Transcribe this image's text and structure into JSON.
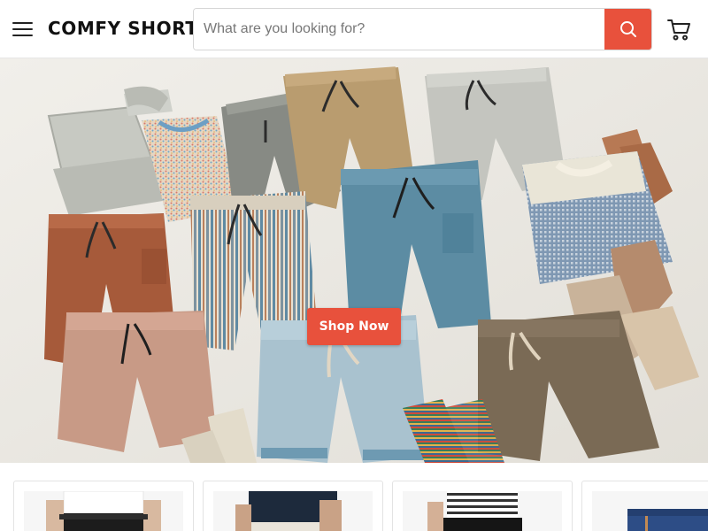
{
  "header": {
    "menu_icon": "hamburger-menu-icon",
    "logo_text": "COMFY SHORT",
    "search": {
      "placeholder": "What are you looking for?",
      "value": "",
      "button_icon": "search-icon"
    },
    "cart_icon": "shopping-cart-icon"
  },
  "hero": {
    "cta_label": "Shop Now",
    "image_subject": "flat lay of shorts, sweaters and socks"
  },
  "product_cards": [
    {
      "image_subject": "shorts with white t-shirt"
    },
    {
      "image_subject": "shorts with navy shirt"
    },
    {
      "image_subject": "shorts with striped shirt"
    },
    {
      "image_subject": "denim shorts"
    }
  ],
  "colors": {
    "accent": "#e8513c",
    "text": "#111111",
    "border": "#d6d6d6"
  }
}
